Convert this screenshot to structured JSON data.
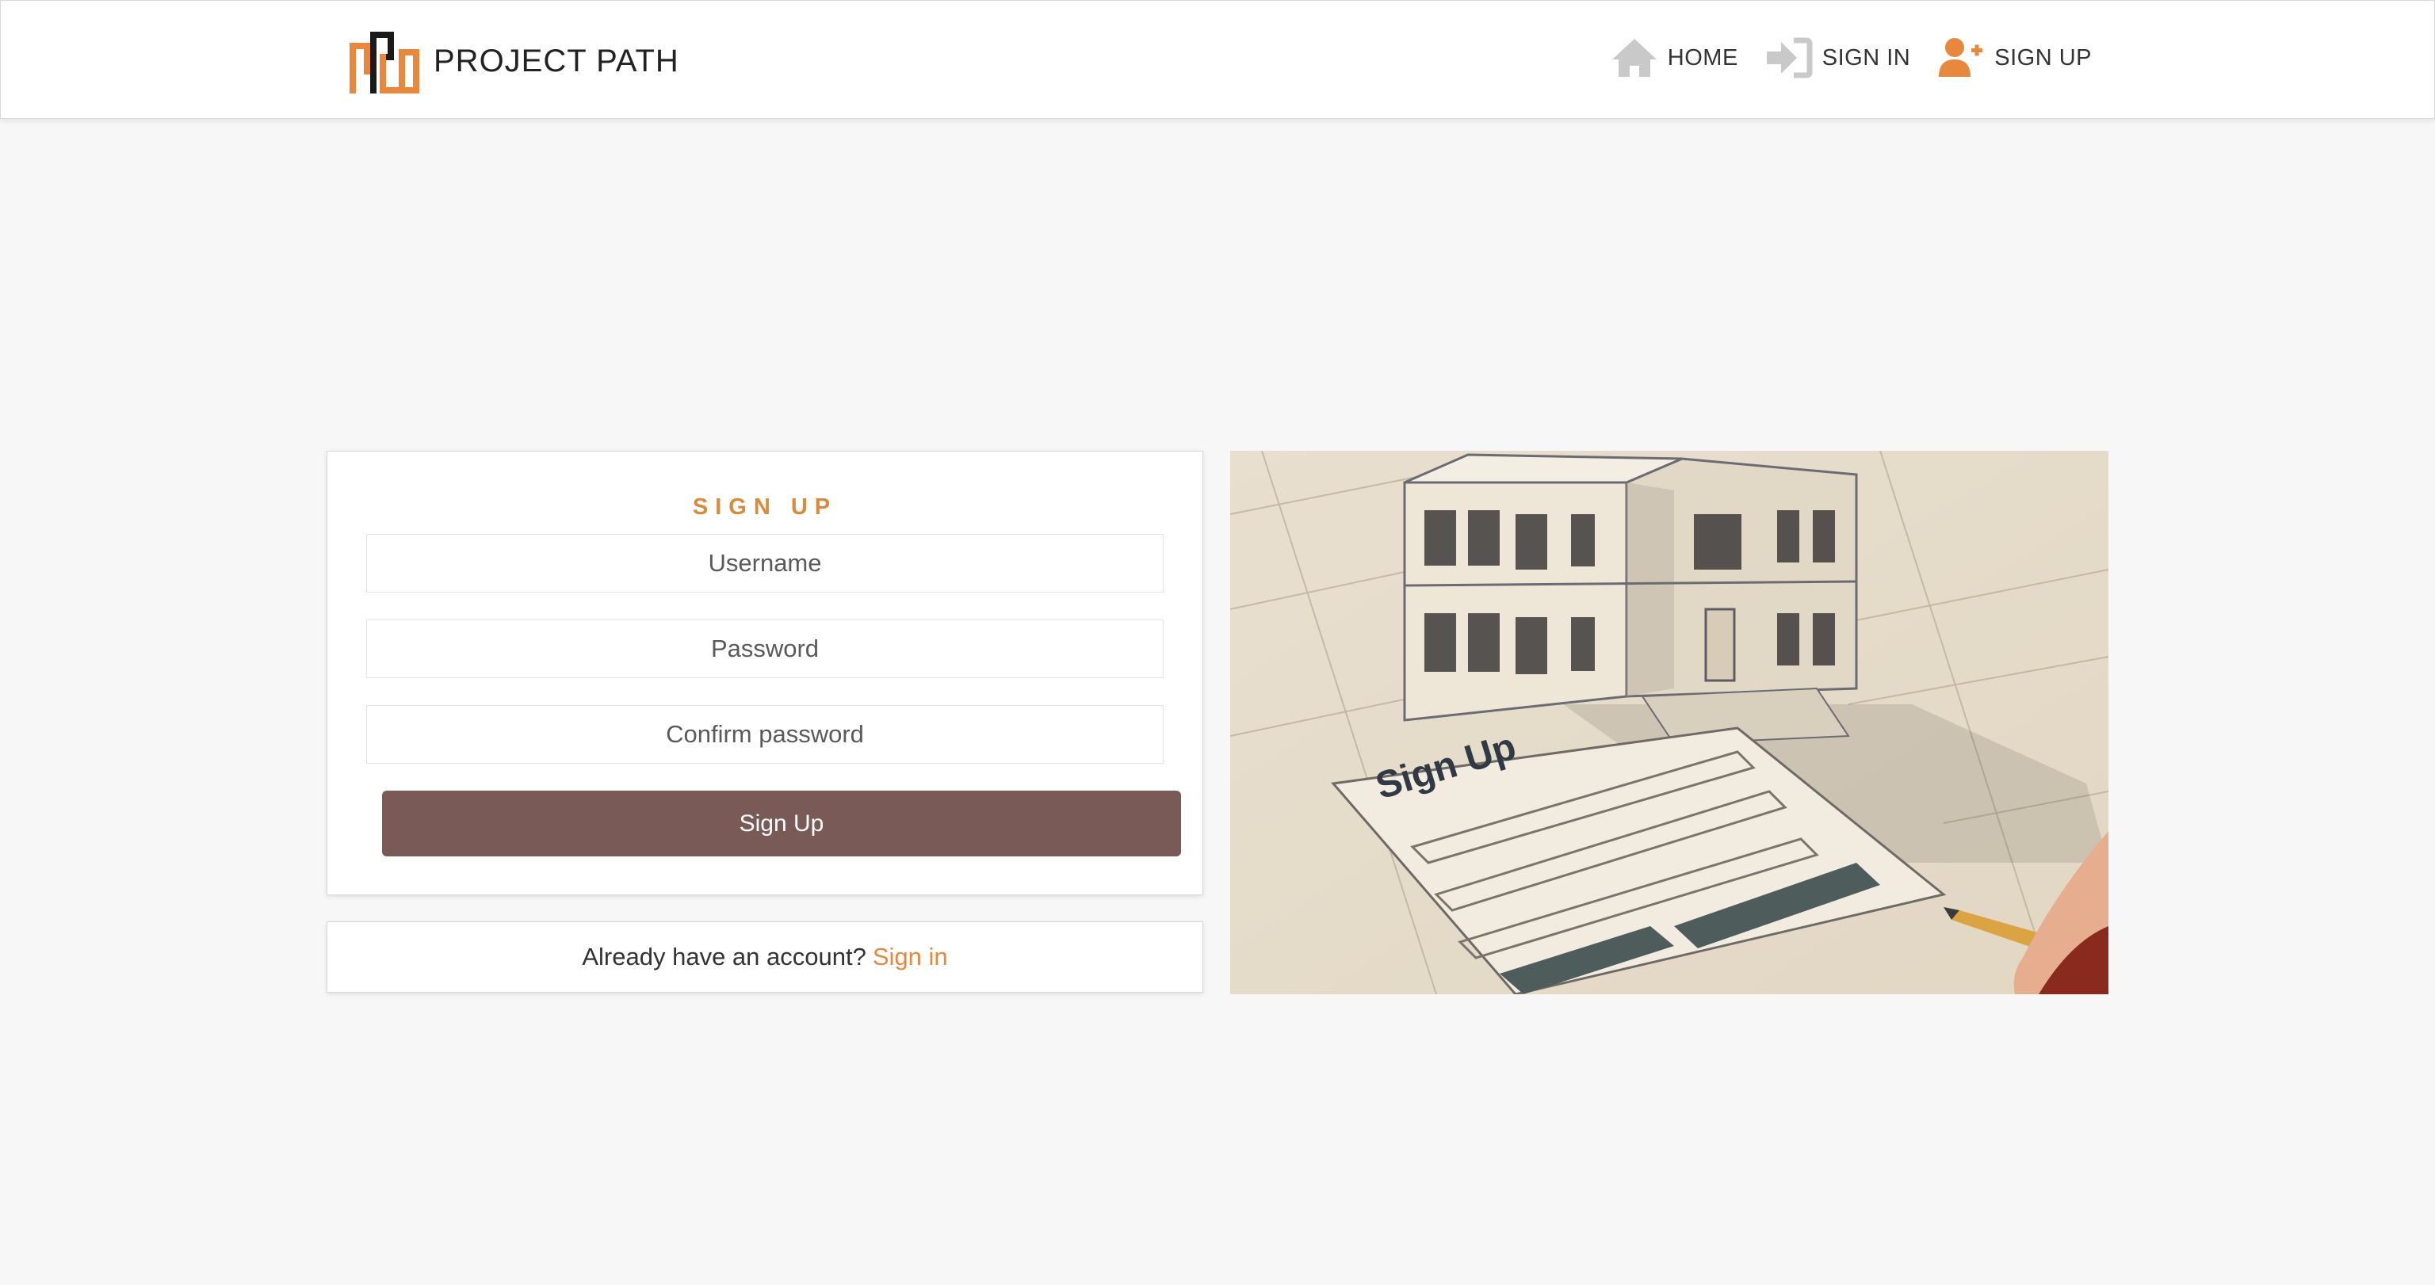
{
  "brand": {
    "name": "PROJECT PATH",
    "logo_icon": "building-logo-icon"
  },
  "nav": {
    "items": [
      {
        "label": "HOME",
        "icon": "home-icon"
      },
      {
        "label": "SIGN IN",
        "icon": "sign-in-icon"
      },
      {
        "label": "SIGN UP",
        "icon": "user-plus-icon"
      }
    ]
  },
  "form": {
    "title": "SIGN UP",
    "username_placeholder": "Username",
    "password_placeholder": "Password",
    "confirm_placeholder": "Confirm password",
    "submit_label": "Sign Up"
  },
  "footer_card": {
    "prompt": "Already have an account?",
    "link_label": "Sign in"
  },
  "illustration": {
    "caption": "Sign Up"
  },
  "colors": {
    "accent": "#d98a3d",
    "link": "#e8883d",
    "button": "#7a5a56",
    "background": "#f7f7f7"
  }
}
